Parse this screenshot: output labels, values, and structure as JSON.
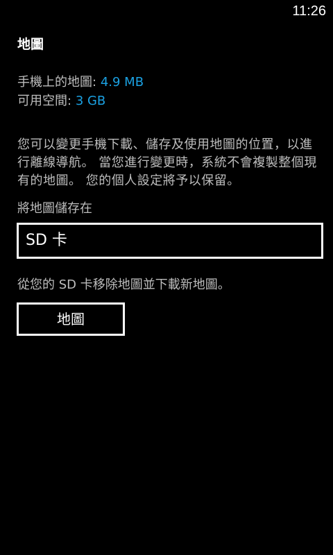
{
  "status_bar": {
    "time": "11:26"
  },
  "page": {
    "title": "地圖"
  },
  "storage_info": {
    "maps_on_phone_label": "手機上的地圖:",
    "maps_on_phone_value": "4.9 MB",
    "available_space_label": "可用空間:",
    "available_space_value": "3 GB"
  },
  "description": "您可以變更手機下載、儲存及使用地圖的位置，以進行離線導航。 當您進行變更時，系統不會複製整個現有的地圖。 您的個人設定將予以保留。",
  "storage_location": {
    "label": "將地圖儲存在",
    "selected_value": "SD 卡"
  },
  "remove_hint": "從您的 SD 卡移除地圖並下載新地圖。",
  "maps_button": {
    "label": "地圖"
  },
  "colors": {
    "background": "#000000",
    "text": "#ffffff",
    "secondary_text": "#bdbdbd",
    "accent": "#1ba1e2"
  }
}
